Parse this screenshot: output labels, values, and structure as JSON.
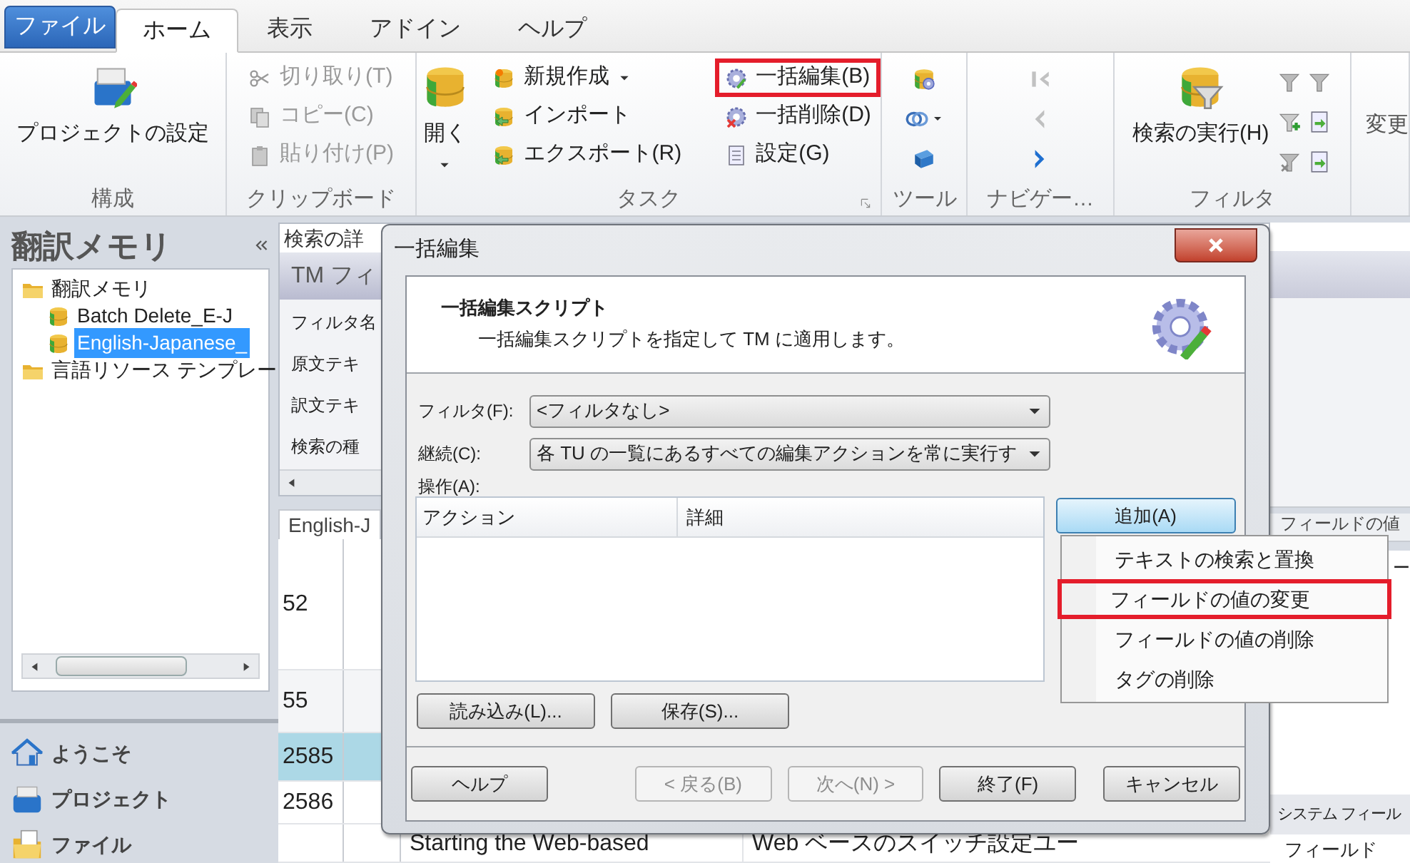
{
  "tabs": [
    {
      "label": "ファイル",
      "kind": "file",
      "selected": false
    },
    {
      "label": "ホーム",
      "kind": "tab",
      "selected": true
    },
    {
      "label": "表示",
      "kind": "tab",
      "selected": false
    },
    {
      "label": "アドイン",
      "kind": "tab",
      "selected": false
    },
    {
      "label": "ヘルプ",
      "kind": "tab",
      "selected": false
    }
  ],
  "ribbon": {
    "groups": [
      {
        "label": "構成",
        "items": [
          {
            "label": "プロジェクトの設定",
            "kind": "large"
          }
        ]
      },
      {
        "label": "クリップボード",
        "items": [
          {
            "label": "切り取り(T)",
            "kind": "small",
            "disabled": true
          },
          {
            "label": "コピー(C)",
            "kind": "small",
            "disabled": true
          },
          {
            "label": "貼り付け(P)",
            "kind": "small",
            "disabled": true
          }
        ]
      },
      {
        "label": "タスク",
        "launcher": true,
        "items": [
          {
            "label": "開く",
            "kind": "large",
            "dropdown": true
          },
          {
            "label": "新規作成",
            "kind": "small",
            "dropdown": true
          },
          {
            "label": "インポート",
            "kind": "small"
          },
          {
            "label": "エクスポート(R)",
            "kind": "small"
          },
          {
            "label": "一括編集(B)",
            "kind": "small",
            "annotated": true
          },
          {
            "label": "一括削除(D)",
            "kind": "small"
          },
          {
            "label": "設定(G)",
            "kind": "small"
          }
        ]
      },
      {
        "label": "ツール",
        "items": [
          {
            "kind": "icon"
          },
          {
            "kind": "icon",
            "dropdown": true
          },
          {
            "kind": "icon"
          }
        ]
      },
      {
        "label": "ナビゲー…",
        "items": [
          {
            "kind": "icon",
            "disabled": true
          },
          {
            "kind": "icon",
            "disabled": true
          },
          {
            "kind": "icon",
            "disabled": false
          }
        ]
      },
      {
        "label": "フィルタ",
        "items": [
          {
            "label": "検索の実行(H)",
            "kind": "large"
          },
          {
            "kind": "icon"
          },
          {
            "kind": "icon"
          },
          {
            "kind": "icon"
          },
          {
            "kind": "icon"
          },
          {
            "kind": "icon"
          },
          {
            "kind": "icon"
          }
        ]
      },
      {
        "items": [
          {
            "label": "変更",
            "kind": "large"
          }
        ]
      }
    ]
  },
  "sidebar": {
    "title": "翻訳メモリ",
    "tree": [
      {
        "label": "翻訳メモリ",
        "kind": "folder",
        "selected": false,
        "children": [
          {
            "label": "Batch Delete_E-J",
            "kind": "tm",
            "selected": false
          },
          {
            "label": "English-Japanese_",
            "kind": "tm",
            "selected": true
          }
        ]
      },
      {
        "label": "言語リソース テンプレー",
        "kind": "folder",
        "selected": false
      }
    ],
    "nav": [
      {
        "label": "ようこそ"
      },
      {
        "label": "プロジェクト"
      },
      {
        "label": "ファイル"
      }
    ]
  },
  "search_panel": {
    "title": "検索の詳",
    "header": "TM フィ",
    "fields": [
      "フィルタ名",
      "原文テキ",
      "訳文テキ",
      "検索の種"
    ]
  },
  "results": {
    "tab": "English-J",
    "rows": [
      {
        "number": "52",
        "selected": false
      },
      {
        "number": "55",
        "selected": false
      },
      {
        "number": "2585",
        "selected": true
      },
      {
        "number": "2586",
        "selected": false
      },
      {
        "source": "Starting the Web-based",
        "target": "Web ベースのスイッチ設定ユー",
        "selected": false
      }
    ]
  },
  "side_panel": {
    "header": "フィールドの値",
    "row": "ー",
    "section": "システム フィール",
    "field": "フィールド"
  },
  "dialog": {
    "title": "一括編集",
    "heading": "一括編集スクリプト",
    "description": "一括編集スクリプトを指定して TM に適用します。",
    "filter_label": "フィルタ(F):",
    "filter_value": "<フィルタなし>",
    "continue_label": "継続(C):",
    "continue_value": "各 TU の一覧にあるすべての編集アクションを常に実行す",
    "actions_label": "操作(A):",
    "columns": [
      "アクション",
      "詳細"
    ],
    "add_button": "追加(A)",
    "load_button": "読み込み(L)...",
    "save_button": "保存(S)...",
    "footer": [
      {
        "label": "ヘルプ",
        "disabled": false
      },
      {
        "label": "< 戻る(B)",
        "disabled": true
      },
      {
        "label": "次へ(N) >",
        "disabled": true
      },
      {
        "label": "終了(F)",
        "disabled": false
      },
      {
        "label": "キャンセル",
        "disabled": false
      }
    ]
  },
  "add_menu": [
    {
      "label": "テキストの検索と置換",
      "annotated": false
    },
    {
      "label": "フィールドの値の変更",
      "annotated": true
    },
    {
      "label": "フィールドの値の削除",
      "annotated": false
    },
    {
      "label": "タグの削除",
      "annotated": false
    }
  ]
}
